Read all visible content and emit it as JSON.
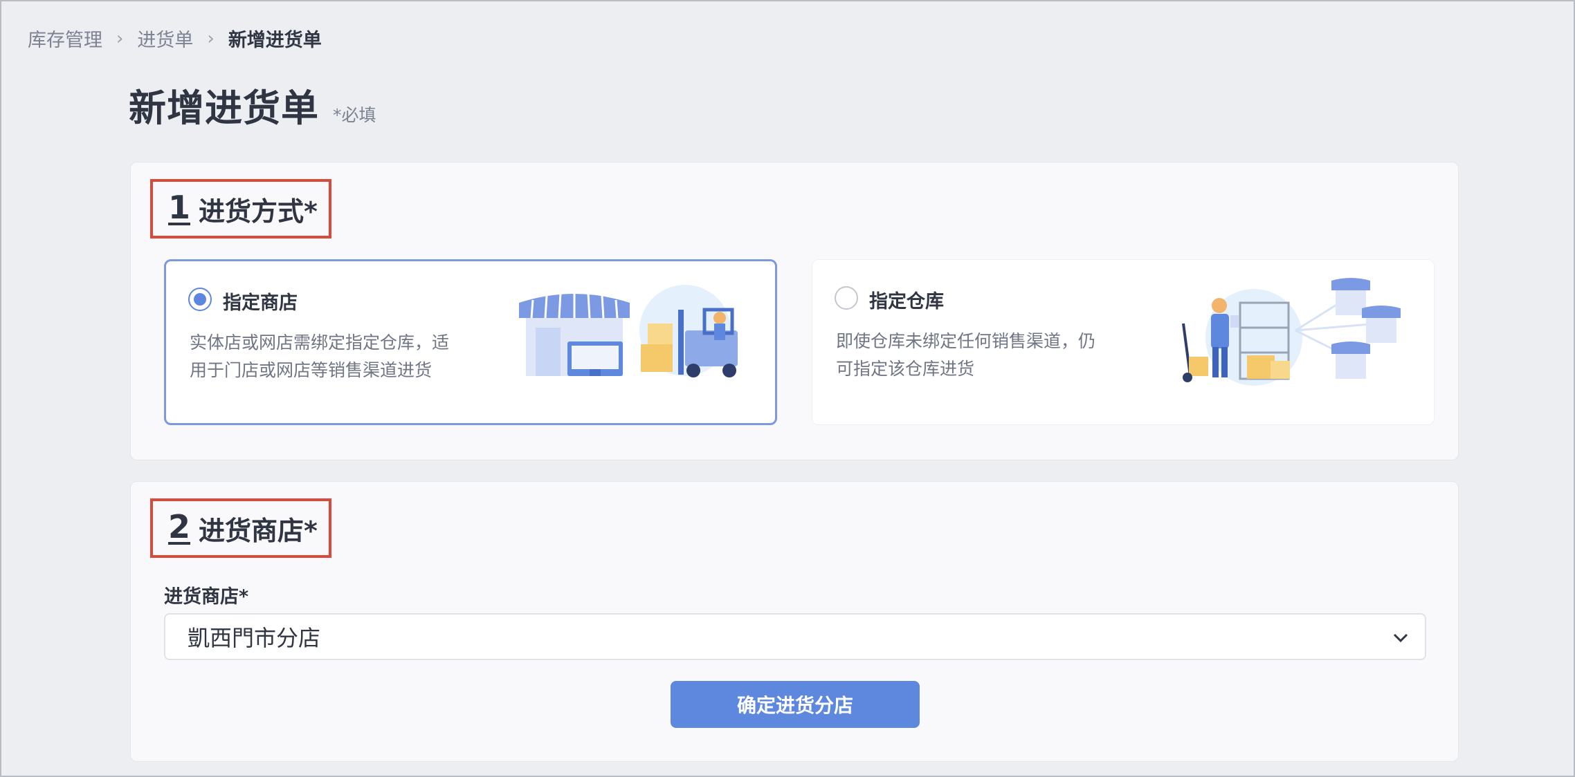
{
  "breadcrumb": {
    "items": [
      "库存管理",
      "进货单",
      "新增进货单"
    ]
  },
  "page": {
    "title": "新增进货单",
    "required_note": "*必填"
  },
  "section1": {
    "number": "1",
    "label": "进货方式*",
    "options": [
      {
        "title": "指定商店",
        "desc_line1": "实体店或网店需绑定指定仓库，适",
        "desc_line2": "用于门店或网店等销售渠道进货",
        "selected": true,
        "illustration": "storefront-forklift-illustration"
      },
      {
        "title": "指定仓库",
        "desc_line1": "即使仓库未绑定任何销售渠道，仍",
        "desc_line2": "可指定该仓库进货",
        "selected": false,
        "illustration": "warehouse-worker-illustration"
      }
    ]
  },
  "section2": {
    "number": "2",
    "label": "进货商店*",
    "field_label": "进货商店*",
    "selected_store": "凱西門市分店",
    "confirm_label": "确定进货分店"
  },
  "colors": {
    "accent": "#5e87de",
    "highlight_border": "#d94a3a",
    "background": "#eceef1"
  }
}
